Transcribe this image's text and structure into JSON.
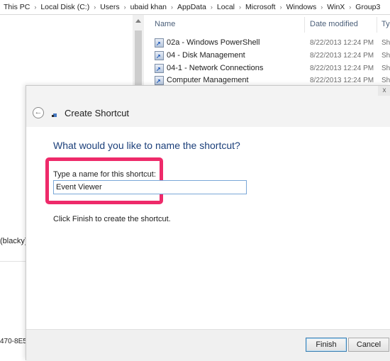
{
  "breadcrumb": [
    "This PC",
    "Local Disk (C:)",
    "Users",
    "ubaid khan",
    "AppData",
    "Local",
    "Microsoft",
    "Windows",
    "WinX",
    "Group3"
  ],
  "left_pane": {
    "partial_item": "(blacky)",
    "bottom_text": "470-8E5"
  },
  "columns": {
    "name": "Name",
    "date": "Date modified",
    "type": "Typ"
  },
  "files": [
    {
      "name": "02a - Windows PowerShell",
      "date": "8/22/2013 12:24 PM",
      "type": "Sho"
    },
    {
      "name": "04 - Disk Management",
      "date": "8/22/2013 12:24 PM",
      "type": "Sho"
    },
    {
      "name": "04-1 - Network Connections",
      "date": "8/22/2013 12:24 PM",
      "type": "Sho"
    },
    {
      "name": "Computer Management",
      "date": "8/22/2013 12:24 PM",
      "type": "Sho"
    }
  ],
  "dialog": {
    "title": "Create Shortcut",
    "close": "x",
    "back": "←",
    "heading": "What would you like to name the shortcut?",
    "field_label": "Type a name for this shortcut:",
    "field_value": "Event Viewer",
    "hint": "Click Finish to create the shortcut.",
    "finish_label": "Finish",
    "cancel_label": "Cancel"
  },
  "colors": {
    "highlight": "#ee2a6a",
    "heading": "#1b3f7a",
    "input_border": "#7aa7d8"
  }
}
